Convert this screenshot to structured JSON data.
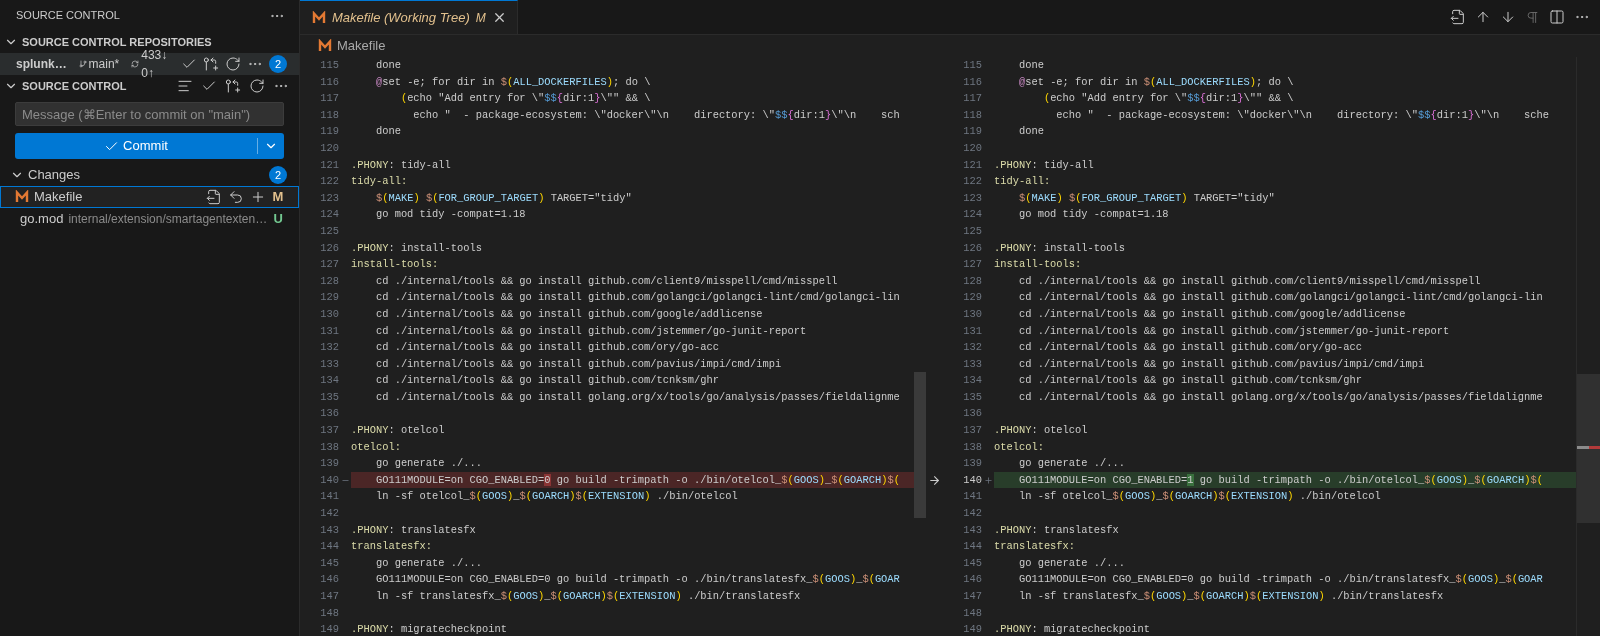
{
  "sidebar": {
    "title": "SOURCE CONTROL",
    "repositories": {
      "title": "SOURCE CONTROL REPOSITORIES",
      "expanded": true,
      "repo": {
        "name": "splunk…",
        "branch": "main*",
        "sync": "433↓ 0↑",
        "badge": "2"
      }
    },
    "source_control": {
      "title": "SOURCE CONTROL",
      "expanded": true,
      "message": {
        "placeholder": "Message (⌘Enter to commit on \"main\")"
      },
      "commit_button": {
        "label": "Commit"
      },
      "changes": {
        "label": "Changes",
        "expanded": true,
        "count": "2",
        "files": [
          {
            "name": "Makefile",
            "kind": "makefile",
            "status": "M",
            "color": "#e2c08d",
            "selected": true
          },
          {
            "name": "go.mod",
            "path": "internal/extension/smartagentexten…",
            "kind": "text",
            "status": "U",
            "color": "#73c991",
            "selected": false
          }
        ]
      }
    }
  },
  "editor": {
    "tabs": [
      {
        "title": "Makefile (Working Tree)",
        "status": "M",
        "selected": true
      }
    ],
    "breadcrumb": [
      "Makefile"
    ],
    "panes": [
      {
        "lines": [
          {
            "number": "115",
            "text": "    done"
          },
          {
            "number": "116",
            "segments": [
              {
                "kind": "at",
                "text": "    @"
              },
              {
                "kind": "plain",
                "text": "set -e; for dir in "
              },
              {
                "kind": "dollar",
                "text": "$"
              },
              {
                "kind": "paren",
                "text": "("
              },
              {
                "kind": "variable",
                "text": "ALL_DOCKERFILES"
              },
              {
                "kind": "paren",
                "text": ")"
              },
              {
                "kind": "plain",
                "text": "; do \\"
              }
            ]
          },
          {
            "number": "117",
            "segments": [
              {
                "kind": "paren",
                "text": "        ("
              },
              {
                "kind": "plain",
                "text": "echo \"Add entry for \\\""
              },
              {
                "kind": "escape",
                "text": "$$"
              },
              {
                "kind": "brace",
                "text": "{"
              },
              {
                "kind": "plain",
                "text": "dir:1"
              },
              {
                "kind": "brace",
                "text": "}"
              },
              {
                "kind": "plain",
                "text": "\\\"\" && \\"
              }
            ]
          },
          {
            "number": "118",
            "segments": [
              {
                "kind": "plain",
                "text": "          echo \"  - package-ecosystem: \\\"docker\\\"\\n    directory: \\\""
              },
              {
                "kind": "escape",
                "text": "$$"
              },
              {
                "kind": "brace",
                "text": "{"
              },
              {
                "kind": "plain",
                "text": "dir:1"
              },
              {
                "kind": "brace",
                "text": "}"
              },
              {
                "kind": "plain",
                "text": "\\\"\\n    sch"
              }
            ]
          },
          {
            "number": "119",
            "text": "    done"
          },
          {
            "number": "120"
          },
          {
            "number": "121",
            "segments": [
              {
                "kind": "target",
                "text": ".PHONY"
              },
              {
                "kind": "plain",
                "text": ": tidy-all"
              }
            ]
          },
          {
            "number": "122",
            "segments": [
              {
                "kind": "target",
                "text": "tidy-all:"
              }
            ]
          },
          {
            "number": "123",
            "segments": [
              {
                "kind": "dollar",
                "text": "    $"
              },
              {
                "kind": "paren",
                "text": "("
              },
              {
                "kind": "variable",
                "text": "MAKE"
              },
              {
                "kind": "paren",
                "text": ")"
              },
              {
                "kind": "dollar",
                "text": " $"
              },
              {
                "kind": "paren",
                "text": "("
              },
              {
                "kind": "variable",
                "text": "FOR_GROUP_TARGET"
              },
              {
                "kind": "paren",
                "text": ")"
              },
              {
                "kind": "plain",
                "text": " TARGET=\"tidy\""
              }
            ]
          },
          {
            "number": "124",
            "text": "    go mod tidy -compat=1.18"
          },
          {
            "number": "125"
          },
          {
            "number": "126",
            "segments": [
              {
                "kind": "target",
                "text": ".PHONY"
              },
              {
                "kind": "plain",
                "text": ": install-tools"
              }
            ]
          },
          {
            "number": "127",
            "segments": [
              {
                "kind": "target",
                "text": "install-tools:"
              }
            ]
          },
          {
            "number": "128",
            "text": "    cd ./internal/tools && go install github.com/client9/misspell/cmd/misspell"
          },
          {
            "number": "129",
            "text": "    cd ./internal/tools && go install github.com/golangci/golangci-lint/cmd/golangci-lin"
          },
          {
            "number": "130",
            "text": "    cd ./internal/tools && go install github.com/google/addlicense"
          },
          {
            "number": "131",
            "text": "    cd ./internal/tools && go install github.com/jstemmer/go-junit-report"
          },
          {
            "number": "132",
            "text": "    cd ./internal/tools && go install github.com/ory/go-acc"
          },
          {
            "number": "133",
            "text": "    cd ./internal/tools && go install github.com/pavius/impi/cmd/impi"
          },
          {
            "number": "134",
            "text": "    cd ./internal/tools && go install github.com/tcnksm/ghr"
          },
          {
            "number": "135",
            "text": "    cd ./internal/tools && go install golang.org/x/tools/go/analysis/passes/fieldalignme"
          },
          {
            "number": "136"
          },
          {
            "number": "137",
            "segments": [
              {
                "kind": "target",
                "text": ".PHONY"
              },
              {
                "kind": "plain",
                "text": ": otelcol"
              }
            ]
          },
          {
            "number": "138",
            "segments": [
              {
                "kind": "target",
                "text": "otelcol:"
              }
            ]
          },
          {
            "number": "139",
            "text": "    go generate ./..."
          },
          {
            "number": "140",
            "kind": "removed",
            "segments": [
              {
                "kind": "plain",
                "text": "    GO111MODULE=on CGO_ENABLED="
              },
              {
                "kind": "changed",
                "text": "0"
              },
              {
                "kind": "plain",
                "text": " go build -trimpath -o ./bin/otelcol_"
              },
              {
                "kind": "dollar",
                "text": "$"
              },
              {
                "kind": "paren",
                "text": "("
              },
              {
                "kind": "variable",
                "text": "GOOS"
              },
              {
                "kind": "paren",
                "text": ")"
              },
              {
                "kind": "plain",
                "text": "_"
              },
              {
                "kind": "dollar",
                "text": "$"
              },
              {
                "kind": "paren",
                "text": "("
              },
              {
                "kind": "variable",
                "text": "GOARCH"
              },
              {
                "kind": "paren",
                "text": ")"
              },
              {
                "kind": "dollar",
                "text": "$"
              },
              {
                "kind": "paren",
                "text": "("
              }
            ]
          },
          {
            "number": "141",
            "segments": [
              {
                "kind": "plain",
                "text": "    ln -sf otelcol_"
              },
              {
                "kind": "dollar",
                "text": "$"
              },
              {
                "kind": "paren",
                "text": "("
              },
              {
                "kind": "variable",
                "text": "GOOS"
              },
              {
                "kind": "paren",
                "text": ")"
              },
              {
                "kind": "plain",
                "text": "_"
              },
              {
                "kind": "dollar",
                "text": "$"
              },
              {
                "kind": "paren",
                "text": "("
              },
              {
                "kind": "variable",
                "text": "GOARCH"
              },
              {
                "kind": "paren",
                "text": ")"
              },
              {
                "kind": "dollar",
                "text": "$"
              },
              {
                "kind": "paren",
                "text": "("
              },
              {
                "kind": "variable",
                "text": "EXTENSION"
              },
              {
                "kind": "paren",
                "text": ")"
              },
              {
                "kind": "plain",
                "text": " ./bin/otelcol"
              }
            ]
          },
          {
            "number": "142"
          },
          {
            "number": "143",
            "segments": [
              {
                "kind": "target",
                "text": ".PHONY"
              },
              {
                "kind": "plain",
                "text": ": translatesfx"
              }
            ]
          },
          {
            "number": "144",
            "segments": [
              {
                "kind": "target",
                "text": "translatesfx:"
              }
            ]
          },
          {
            "number": "145",
            "text": "    go generate ./..."
          },
          {
            "number": "146",
            "segments": [
              {
                "kind": "plain",
                "text": "    GO111MODULE=on CGO_ENABLED=0 go build -trimpath -o ./bin/translatesfx_"
              },
              {
                "kind": "dollar",
                "text": "$"
              },
              {
                "kind": "paren",
                "text": "("
              },
              {
                "kind": "variable",
                "text": "GOOS"
              },
              {
                "kind": "paren",
                "text": ")"
              },
              {
                "kind": "plain",
                "text": "_"
              },
              {
                "kind": "dollar",
                "text": "$"
              },
              {
                "kind": "paren",
                "text": "("
              },
              {
                "kind": "variable",
                "text": "GOAR"
              }
            ]
          },
          {
            "number": "147",
            "segments": [
              {
                "kind": "plain",
                "text": "    ln -sf translatesfx_"
              },
              {
                "kind": "dollar",
                "text": "$"
              },
              {
                "kind": "paren",
                "text": "("
              },
              {
                "kind": "variable",
                "text": "GOOS"
              },
              {
                "kind": "paren",
                "text": ")"
              },
              {
                "kind": "plain",
                "text": "_"
              },
              {
                "kind": "dollar",
                "text": "$"
              },
              {
                "kind": "paren",
                "text": "("
              },
              {
                "kind": "variable",
                "text": "GOARCH"
              },
              {
                "kind": "paren",
                "text": ")"
              },
              {
                "kind": "dollar",
                "text": "$"
              },
              {
                "kind": "paren",
                "text": "("
              },
              {
                "kind": "variable",
                "text": "EXTENSION"
              },
              {
                "kind": "paren",
                "text": ")"
              },
              {
                "kind": "plain",
                "text": " ./bin/translatesfx"
              }
            ]
          },
          {
            "number": "148"
          },
          {
            "number": "149",
            "segments": [
              {
                "kind": "target",
                "text": ".PHONY"
              },
              {
                "kind": "plain",
                "text": ": migratecheckpoint"
              }
            ]
          }
        ]
      },
      {
        "lines": [
          {
            "number": "115",
            "text": "    done"
          },
          {
            "number": "116",
            "segments": [
              {
                "kind": "at",
                "text": "    @"
              },
              {
                "kind": "plain",
                "text": "set -e; for dir in "
              },
              {
                "kind": "dollar",
                "text": "$"
              },
              {
                "kind": "paren",
                "text": "("
              },
              {
                "kind": "variable",
                "text": "ALL_DOCKERFILES"
              },
              {
                "kind": "paren",
                "text": ")"
              },
              {
                "kind": "plain",
                "text": "; do \\"
              }
            ]
          },
          {
            "number": "117",
            "segments": [
              {
                "kind": "paren",
                "text": "        ("
              },
              {
                "kind": "plain",
                "text": "echo \"Add entry for \\\""
              },
              {
                "kind": "escape",
                "text": "$$"
              },
              {
                "kind": "brace",
                "text": "{"
              },
              {
                "kind": "plain",
                "text": "dir:1"
              },
              {
                "kind": "brace",
                "text": "}"
              },
              {
                "kind": "plain",
                "text": "\\\"\" && \\"
              }
            ]
          },
          {
            "number": "118",
            "segments": [
              {
                "kind": "plain",
                "text": "          echo \"  - package-ecosystem: \\\"docker\\\"\\n    directory: \\\""
              },
              {
                "kind": "escape",
                "text": "$$"
              },
              {
                "kind": "brace",
                "text": "{"
              },
              {
                "kind": "plain",
                "text": "dir:1"
              },
              {
                "kind": "brace",
                "text": "}"
              },
              {
                "kind": "plain",
                "text": "\\\"\\n    sche"
              }
            ]
          },
          {
            "number": "119",
            "text": "    done"
          },
          {
            "number": "120"
          },
          {
            "number": "121",
            "segments": [
              {
                "kind": "target",
                "text": ".PHONY"
              },
              {
                "kind": "plain",
                "text": ": tidy-all"
              }
            ]
          },
          {
            "number": "122",
            "segments": [
              {
                "kind": "target",
                "text": "tidy-all:"
              }
            ]
          },
          {
            "number": "123",
            "segments": [
              {
                "kind": "dollar",
                "text": "    $"
              },
              {
                "kind": "paren",
                "text": "("
              },
              {
                "kind": "variable",
                "text": "MAKE"
              },
              {
                "kind": "paren",
                "text": ")"
              },
              {
                "kind": "dollar",
                "text": " $"
              },
              {
                "kind": "paren",
                "text": "("
              },
              {
                "kind": "variable",
                "text": "FOR_GROUP_TARGET"
              },
              {
                "kind": "paren",
                "text": ")"
              },
              {
                "kind": "plain",
                "text": " TARGET=\"tidy\""
              }
            ]
          },
          {
            "number": "124",
            "text": "    go mod tidy -compat=1.18"
          },
          {
            "number": "125"
          },
          {
            "number": "126",
            "segments": [
              {
                "kind": "target",
                "text": ".PHONY"
              },
              {
                "kind": "plain",
                "text": ": install-tools"
              }
            ]
          },
          {
            "number": "127",
            "segments": [
              {
                "kind": "target",
                "text": "install-tools:"
              }
            ]
          },
          {
            "number": "128",
            "text": "    cd ./internal/tools && go install github.com/client9/misspell/cmd/misspell"
          },
          {
            "number": "129",
            "text": "    cd ./internal/tools && go install github.com/golangci/golangci-lint/cmd/golangci-lin"
          },
          {
            "number": "130",
            "text": "    cd ./internal/tools && go install github.com/google/addlicense"
          },
          {
            "number": "131",
            "text": "    cd ./internal/tools && go install github.com/jstemmer/go-junit-report"
          },
          {
            "number": "132",
            "text": "    cd ./internal/tools && go install github.com/ory/go-acc"
          },
          {
            "number": "133",
            "text": "    cd ./internal/tools && go install github.com/pavius/impi/cmd/impi"
          },
          {
            "number": "134",
            "text": "    cd ./internal/tools && go install github.com/tcnksm/ghr"
          },
          {
            "number": "135",
            "text": "    cd ./internal/tools && go install golang.org/x/tools/go/analysis/passes/fieldalignme"
          },
          {
            "number": "136"
          },
          {
            "number": "137",
            "segments": [
              {
                "kind": "target",
                "text": ".PHONY"
              },
              {
                "kind": "plain",
                "text": ": otelcol"
              }
            ]
          },
          {
            "number": "138",
            "segments": [
              {
                "kind": "target",
                "text": "otelcol:"
              }
            ]
          },
          {
            "number": "139",
            "text": "    go generate ./..."
          },
          {
            "number": "140",
            "kind": "added",
            "segments": [
              {
                "kind": "plain",
                "text": "    GO111MODULE=on CGO_ENABLED="
              },
              {
                "kind": "changed",
                "text": "1"
              },
              {
                "kind": "plain",
                "text": " go build -trimpath -o ./bin/otelcol_"
              },
              {
                "kind": "dollar",
                "text": "$"
              },
              {
                "kind": "paren",
                "text": "("
              },
              {
                "kind": "variable",
                "text": "GOOS"
              },
              {
                "kind": "paren",
                "text": ")"
              },
              {
                "kind": "plain",
                "text": "_"
              },
              {
                "kind": "dollar",
                "text": "$"
              },
              {
                "kind": "paren",
                "text": "("
              },
              {
                "kind": "variable",
                "text": "GOARCH"
              },
              {
                "kind": "paren",
                "text": ")"
              },
              {
                "kind": "dollar",
                "text": "$"
              },
              {
                "kind": "paren",
                "text": "("
              }
            ]
          },
          {
            "number": "141",
            "segments": [
              {
                "kind": "plain",
                "text": "    ln -sf otelcol_"
              },
              {
                "kind": "dollar",
                "text": "$"
              },
              {
                "kind": "paren",
                "text": "("
              },
              {
                "kind": "variable",
                "text": "GOOS"
              },
              {
                "kind": "paren",
                "text": ")"
              },
              {
                "kind": "plain",
                "text": "_"
              },
              {
                "kind": "dollar",
                "text": "$"
              },
              {
                "kind": "paren",
                "text": "("
              },
              {
                "kind": "variable",
                "text": "GOARCH"
              },
              {
                "kind": "paren",
                "text": ")"
              },
              {
                "kind": "dollar",
                "text": "$"
              },
              {
                "kind": "paren",
                "text": "("
              },
              {
                "kind": "variable",
                "text": "EXTENSION"
              },
              {
                "kind": "paren",
                "text": ")"
              },
              {
                "kind": "plain",
                "text": " ./bin/otelcol"
              }
            ]
          },
          {
            "number": "142"
          },
          {
            "number": "143",
            "segments": [
              {
                "kind": "target",
                "text": ".PHONY"
              },
              {
                "kind": "plain",
                "text": ": translatesfx"
              }
            ]
          },
          {
            "number": "144",
            "segments": [
              {
                "kind": "target",
                "text": "translatesfx:"
              }
            ]
          },
          {
            "number": "145",
            "text": "    go generate ./..."
          },
          {
            "number": "146",
            "segments": [
              {
                "kind": "plain",
                "text": "    GO111MODULE=on CGO_ENABLED=0 go build -trimpath -o ./bin/translatesfx_"
              },
              {
                "kind": "dollar",
                "text": "$"
              },
              {
                "kind": "paren",
                "text": "("
              },
              {
                "kind": "variable",
                "text": "GOOS"
              },
              {
                "kind": "paren",
                "text": ")"
              },
              {
                "kind": "plain",
                "text": "_"
              },
              {
                "kind": "dollar",
                "text": "$"
              },
              {
                "kind": "paren",
                "text": "("
              },
              {
                "kind": "variable",
                "text": "GOAR"
              }
            ]
          },
          {
            "number": "147",
            "segments": [
              {
                "kind": "plain",
                "text": "    ln -sf translatesfx_"
              },
              {
                "kind": "dollar",
                "text": "$"
              },
              {
                "kind": "paren",
                "text": "("
              },
              {
                "kind": "variable",
                "text": "GOOS"
              },
              {
                "kind": "paren",
                "text": ")"
              },
              {
                "kind": "plain",
                "text": "_"
              },
              {
                "kind": "dollar",
                "text": "$"
              },
              {
                "kind": "paren",
                "text": "("
              },
              {
                "kind": "variable",
                "text": "GOARCH"
              },
              {
                "kind": "paren",
                "text": ")"
              },
              {
                "kind": "dollar",
                "text": "$"
              },
              {
                "kind": "paren",
                "text": "("
              },
              {
                "kind": "variable",
                "text": "EXTENSION"
              },
              {
                "kind": "paren",
                "text": ")"
              },
              {
                "kind": "plain",
                "text": " ./bin/translatesfx"
              }
            ]
          },
          {
            "number": "148"
          },
          {
            "number": "149",
            "segments": [
              {
                "kind": "target",
                "text": ".PHONY"
              },
              {
                "kind": "plain",
                "text": ": migratecheckpoint"
              }
            ]
          }
        ]
      }
    ]
  }
}
